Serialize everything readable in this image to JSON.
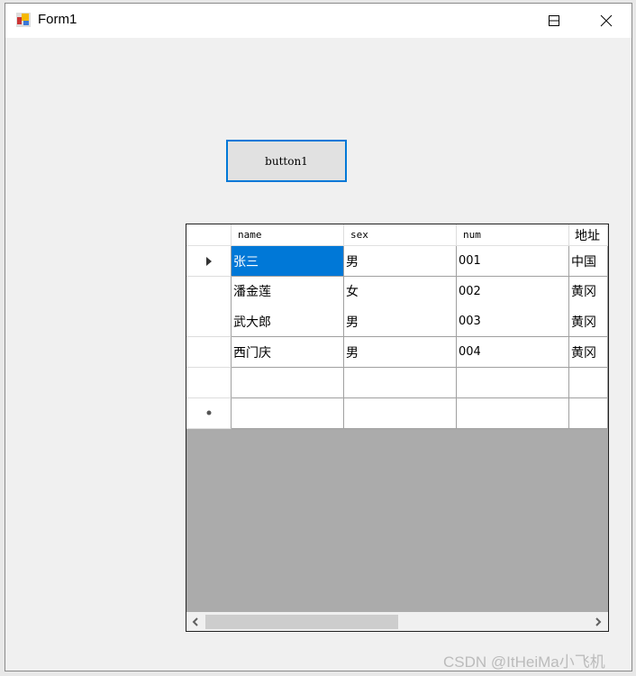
{
  "window": {
    "title": "Form1"
  },
  "button1": {
    "label": "button1"
  },
  "grid": {
    "columns": [
      "name",
      "sex",
      "num",
      "地址"
    ],
    "rows": [
      [
        "张三",
        "男",
        "001",
        "中国"
      ],
      [
        "潘金莲",
        "女",
        "002",
        "黄冈"
      ],
      [
        "武大郎",
        "男",
        "003",
        "黄冈"
      ],
      [
        "西门庆",
        "男",
        "004",
        "黄冈"
      ],
      [
        "",
        "",
        "",
        ""
      ]
    ],
    "selected_cell": {
      "row": 0,
      "column": "name"
    },
    "selection_color": "#0078d7",
    "horizontal_scroll_fraction": 0.5
  },
  "watermark": "CSDN @ItHeiMa小飞机"
}
